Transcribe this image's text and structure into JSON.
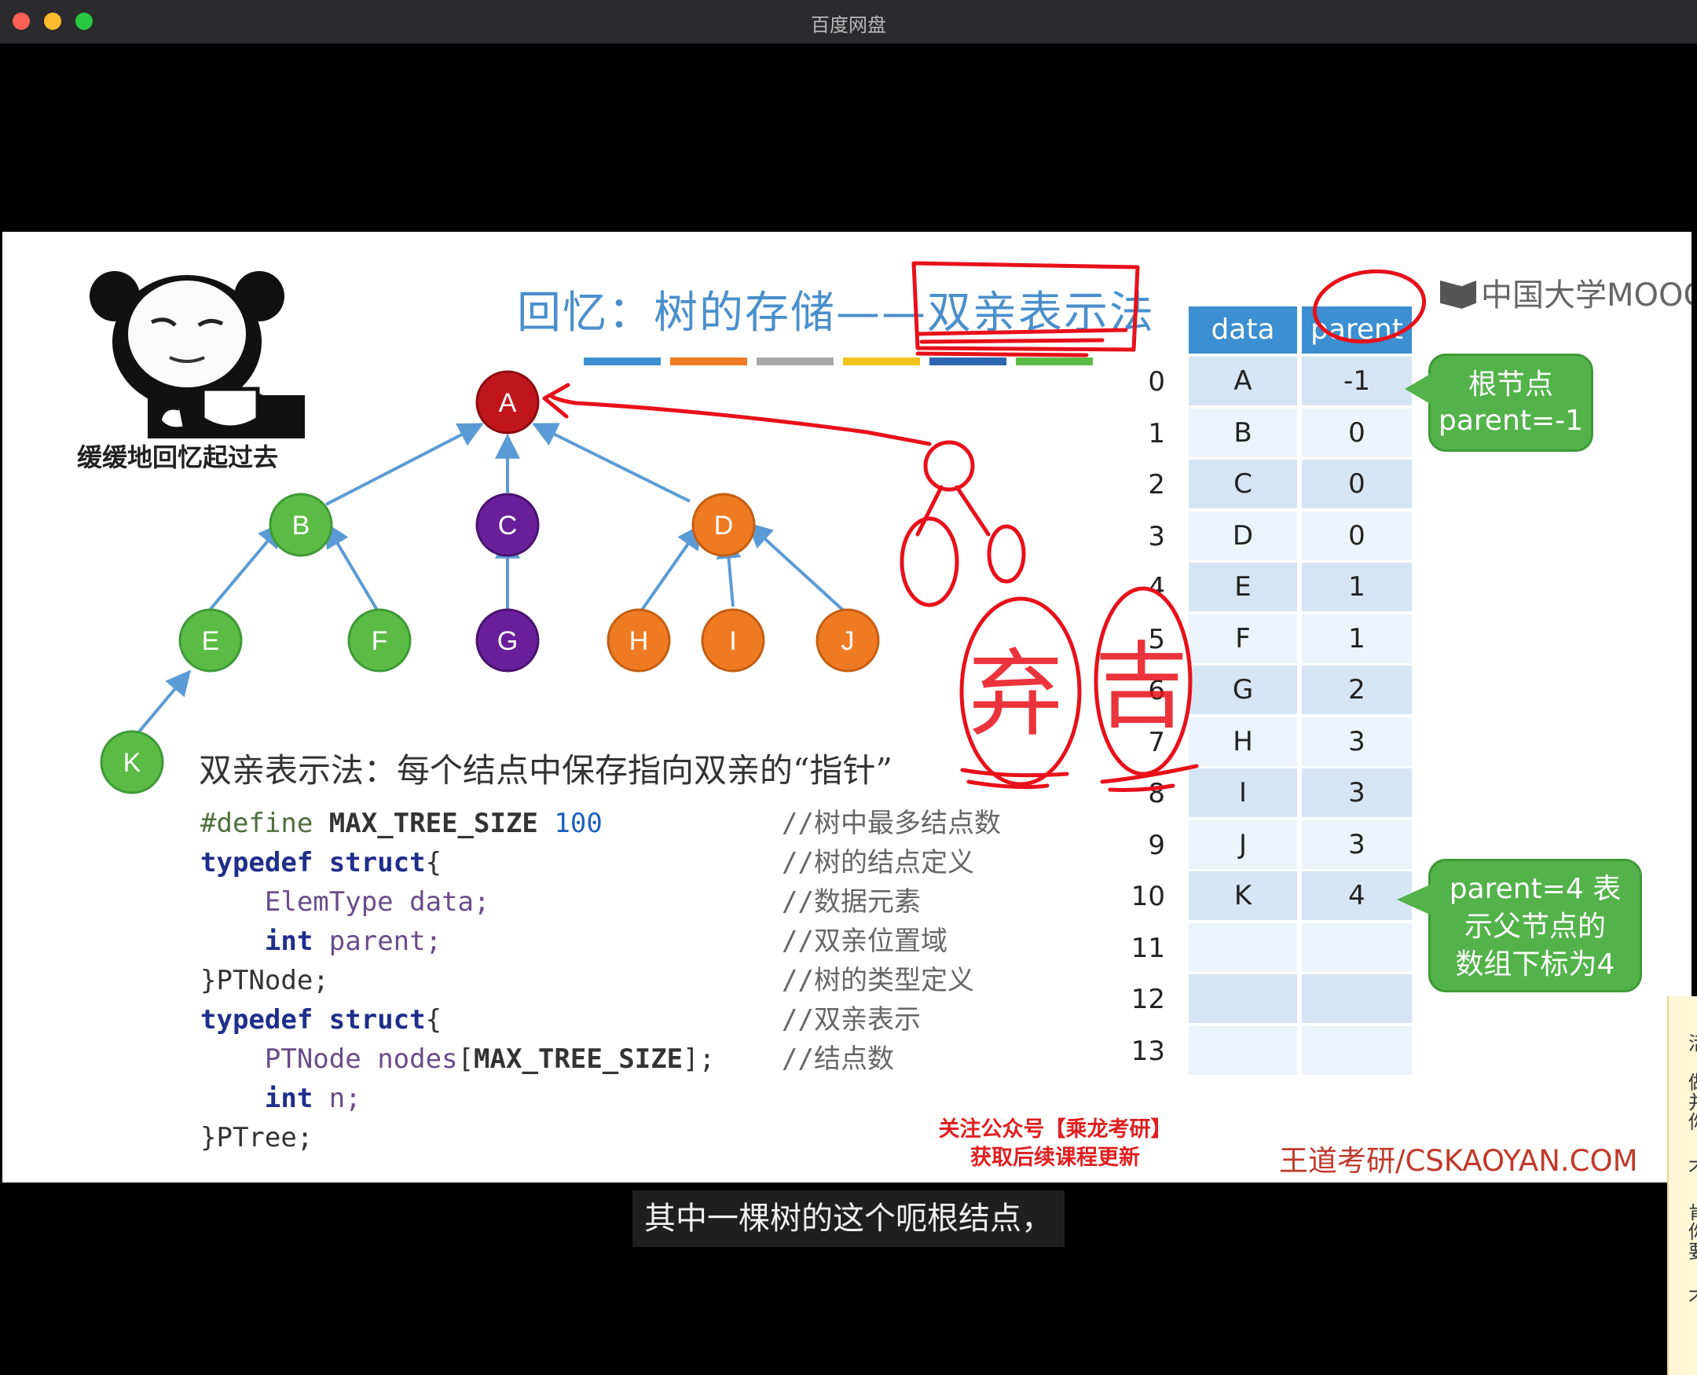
{
  "window": {
    "title": "百度网盘"
  },
  "slide": {
    "title": "回忆：树的存储——双亲表示法",
    "logo": "中国大学MOOC",
    "meme_caption": "缓缓地回忆起过去",
    "tree_nodes": [
      {
        "label": "A",
        "color": "#c0161b"
      },
      {
        "label": "B",
        "color": "#5bbb45"
      },
      {
        "label": "C",
        "color": "#6a1f9a"
      },
      {
        "label": "D",
        "color": "#ee7a22"
      },
      {
        "label": "E",
        "color": "#5bbb45"
      },
      {
        "label": "F",
        "color": "#5bbb45"
      },
      {
        "label": "G",
        "color": "#6a1f9a"
      },
      {
        "label": "H",
        "color": "#ee7a22"
      },
      {
        "label": "I",
        "color": "#ee7a22"
      },
      {
        "label": "J",
        "color": "#ee7a22"
      },
      {
        "label": "K",
        "color": "#5bbb45"
      }
    ],
    "description": "双亲表示法：每个结点中保存指向双亲的“指针”",
    "code": {
      "l1a": "#define",
      "l1b": "MAX_TREE_SIZE",
      "l1c": "100",
      "l2a": "typedef",
      "l2b": "struct",
      "l2c": "{",
      "l3a": "ElemType",
      "l3b": "data;",
      "l4a": "int",
      "l4b": "parent;",
      "l5": "}PTNode;",
      "l6a": "typedef",
      "l6b": "struct",
      "l6c": "{",
      "l7a": "PTNode",
      "l7b": "nodes",
      "l7c": "[",
      "l7d": "MAX_TREE_SIZE",
      "l7e": "];",
      "l8a": "int",
      "l8b": "n;",
      "l9": "}PTree;"
    },
    "comments": [
      "//树中最多结点数",
      "//树的结点定义",
      "//数据元素",
      "//双亲位置域",
      "",
      "//树的类型定义",
      "//双亲表示",
      "//结点数"
    ],
    "promo_line1": "关注公众号【乘龙考研】",
    "promo_line2": "获取后续课程更新",
    "brand": "王道考研/CSKAOYAN.COM",
    "table": {
      "header_data": "data",
      "header_parent": "parent",
      "rows": [
        {
          "i": "0",
          "d": "A",
          "p": "-1"
        },
        {
          "i": "1",
          "d": "B",
          "p": "0"
        },
        {
          "i": "2",
          "d": "C",
          "p": "0"
        },
        {
          "i": "3",
          "d": "D",
          "p": "0"
        },
        {
          "i": "4",
          "d": "E",
          "p": "1"
        },
        {
          "i": "5",
          "d": "F",
          "p": "1"
        },
        {
          "i": "6",
          "d": "G",
          "p": "2"
        },
        {
          "i": "7",
          "d": "H",
          "p": "3"
        },
        {
          "i": "8",
          "d": "I",
          "p": "3"
        },
        {
          "i": "9",
          "d": "J",
          "p": "3"
        },
        {
          "i": "10",
          "d": "K",
          "p": "4"
        },
        {
          "i": "11",
          "d": "",
          "p": ""
        },
        {
          "i": "12",
          "d": "",
          "p": ""
        },
        {
          "i": "13",
          "d": "",
          "p": ""
        }
      ]
    },
    "callout_root_1": "根节点",
    "callout_root_2": "parent=-1",
    "callout_k_1": "parent=4 表",
    "callout_k_2": "示父节点的",
    "callout_k_3": "数组下标为4",
    "handwriting": {
      "char1": "弃",
      "char2": "吉",
      "color": "#e8101a"
    }
  },
  "subtitle": "其中一棵树的这个呃根结点，",
  "side_panel_chars": [
    "活",
    "做",
    "并",
    "你",
    "不",
    "肯",
    "你",
    "要",
    "不"
  ]
}
